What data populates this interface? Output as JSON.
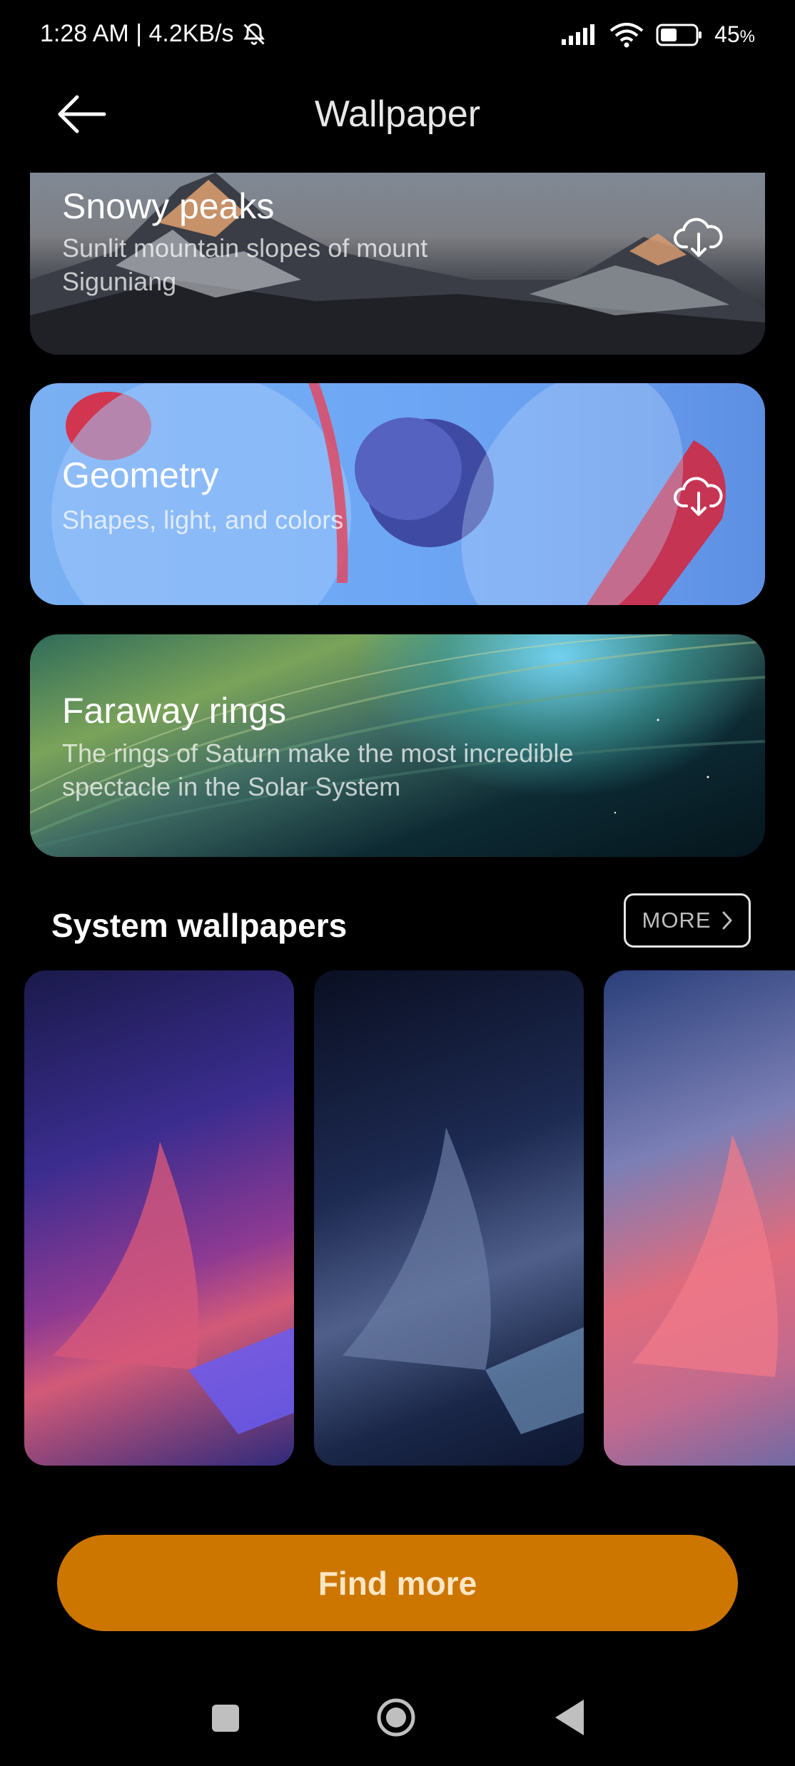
{
  "status_bar": {
    "time_speed": "1:28 AM | 4.2KB/s",
    "battery": "45",
    "battery_unit": "%"
  },
  "header": {
    "title": "Wallpaper"
  },
  "cards": [
    {
      "title": "Snowy peaks",
      "subtitle": "Sunlit mountain slopes of mount Siguniang",
      "icon": "cloud-download-icon"
    },
    {
      "title": "Geometry",
      "subtitle": "Shapes, light, and colors",
      "icon": "cloud-download-icon"
    },
    {
      "title": "Faraway rings",
      "subtitle": "The rings of Saturn make the most incredible spectacle in the Solar System"
    }
  ],
  "section": {
    "title": "System wallpapers",
    "more_label": "MORE"
  },
  "find_more": "Find more",
  "colors": {
    "accent": "#cc7600",
    "background": "#000000"
  }
}
